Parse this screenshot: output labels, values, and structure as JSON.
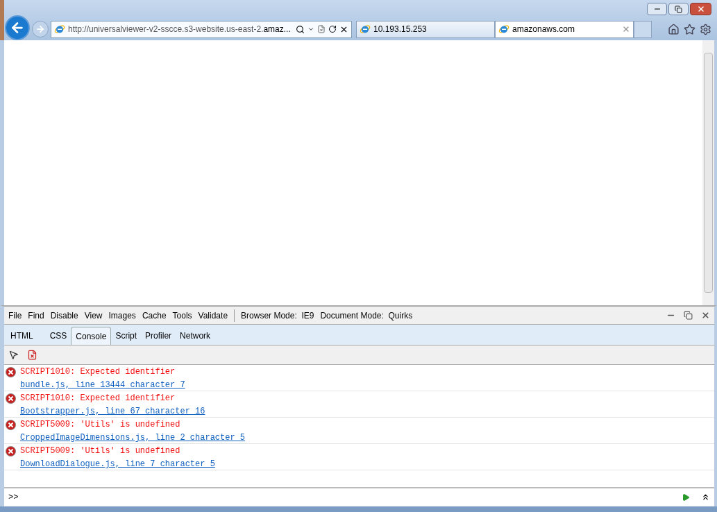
{
  "address_bar": {
    "url": "http://universalviewer-v2-sscce.s3-website.us-east-2.",
    "url_domain": "amaz..."
  },
  "browser_tabs": [
    {
      "title": "10.193.15.253",
      "selected": false
    },
    {
      "title": "amazonaws.com",
      "selected": true
    }
  ],
  "devtools": {
    "menu": [
      "File",
      "Find",
      "Disable",
      "View",
      "Images",
      "Cache",
      "Tools",
      "Validate"
    ],
    "modes": [
      "Browser Mode:  IE9",
      "Document Mode:  Quirks"
    ],
    "tabs": [
      {
        "label": "HTML",
        "selected": false
      },
      {
        "label": "CSS",
        "selected": false
      },
      {
        "label": "Console",
        "selected": true
      },
      {
        "label": "Script",
        "selected": false
      },
      {
        "label": "Profiler",
        "selected": false
      },
      {
        "label": "Network",
        "selected": false
      }
    ],
    "console": [
      {
        "kind": "error",
        "message": "SCRIPT1010: Expected identifier",
        "source": "bundle.js, line 13444 character 7"
      },
      {
        "kind": "error",
        "message": "SCRIPT1010: Expected identifier",
        "source": "Bootstrapper.js, line 67 character 16"
      },
      {
        "kind": "error",
        "message": "SCRIPT5009: 'Utils' is undefined",
        "source": "CroppedImageDimensions.js, line 2 character 5"
      },
      {
        "kind": "error",
        "message": "SCRIPT5009: 'Utils' is undefined",
        "source": "DownloadDialogue.js, line 7 character 5"
      }
    ],
    "prompt": ">>"
  }
}
